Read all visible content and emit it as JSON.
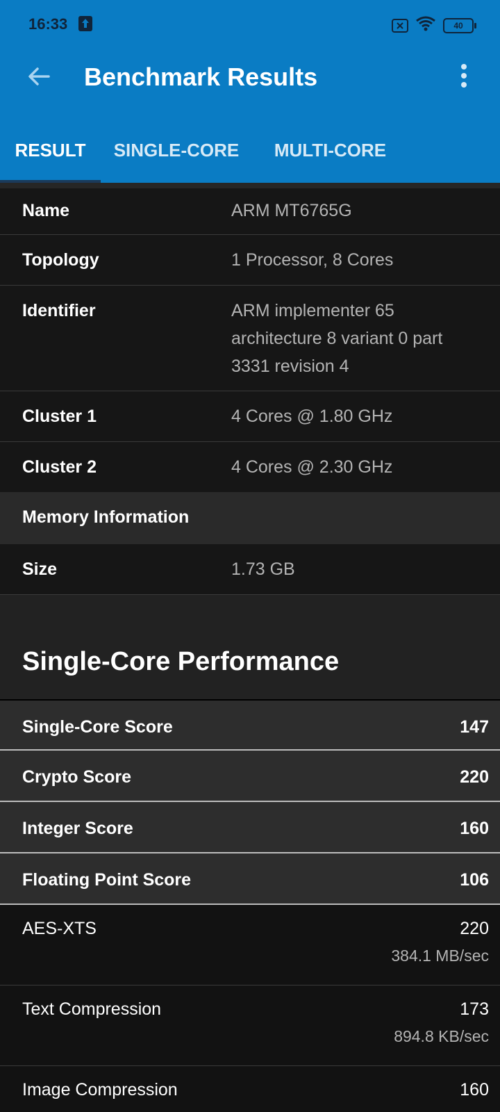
{
  "status_bar": {
    "time": "16:33",
    "battery": "40"
  },
  "header": {
    "title": "Benchmark Results"
  },
  "tabs": [
    {
      "label": "RESULT"
    },
    {
      "label": "SINGLE-CORE"
    },
    {
      "label": "MULTI-CORE"
    }
  ],
  "processor_info": [
    {
      "key": "Name",
      "value": "ARM MT6765G"
    },
    {
      "key": "Topology",
      "value": "1 Processor, 8 Cores"
    },
    {
      "key": "Identifier",
      "value": "ARM implementer 65 architecture 8 variant 0 part 3331 revision 4"
    },
    {
      "key": "Cluster 1",
      "value": "4 Cores @ 1.80 GHz"
    },
    {
      "key": "Cluster 2",
      "value": "4 Cores @ 2.30 GHz"
    }
  ],
  "memory": {
    "section_title": "Memory Information",
    "key": "Size",
    "value": "1.73 GB"
  },
  "single_core": {
    "title": "Single-Core Performance",
    "scores": [
      {
        "label": "Single-Core Score",
        "value": "147"
      },
      {
        "label": "Crypto Score",
        "value": "220"
      },
      {
        "label": "Integer Score",
        "value": "160"
      },
      {
        "label": "Floating Point Score",
        "value": "106"
      }
    ],
    "workloads": [
      {
        "label": "AES-XTS",
        "score": "220",
        "rate": "384.1 MB/sec"
      },
      {
        "label": "Text Compression",
        "score": "173",
        "rate": "894.8 KB/sec"
      },
      {
        "label": "Image Compression",
        "score": "160",
        "rate": ""
      }
    ]
  }
}
